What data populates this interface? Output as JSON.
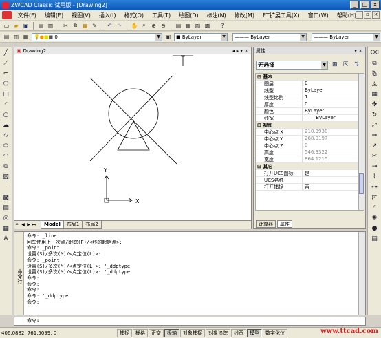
{
  "title": "ZWCAD Classic 试用版 - [Drawing2]",
  "menu": [
    "文件(F)",
    "编辑(E)",
    "视图(V)",
    "插入(I)",
    "格式(O)",
    "工具(T)",
    "绘图(D)",
    "标注(N)",
    "修改(M)",
    "ET扩展工具(X)",
    "窗口(W)",
    "帮助(H)"
  ],
  "toolbar": {
    "layer_value": "0",
    "color_value": "ByLayer",
    "linetype_value": "ByLayer",
    "lineweight_value": "ByLayer"
  },
  "drawing": {
    "tab_title": "Drawing2",
    "tabs": [
      "Model",
      "布局1",
      "布局2"
    ]
  },
  "ucs": {
    "x_label": "X",
    "y_label": "Y"
  },
  "properties": {
    "panel_title": "属性",
    "selection": "无选择",
    "rows": [
      {
        "cat": "基本"
      },
      {
        "k": "图层",
        "v": "0"
      },
      {
        "k": "线型",
        "v": "ByLayer"
      },
      {
        "k": "线型比例",
        "v": "1"
      },
      {
        "k": "厚度",
        "v": "0"
      },
      {
        "k": "颜色",
        "v": "ByLayer"
      },
      {
        "k": "线宽",
        "v": "—— ByLayer"
      },
      {
        "cat": "视图"
      },
      {
        "k": "中心点 X",
        "v": "210.3938",
        "gray": true
      },
      {
        "k": "中心点 Y",
        "v": "268.0197",
        "gray": true
      },
      {
        "k": "中心点 Z",
        "v": "0",
        "gray": true
      },
      {
        "k": "高度",
        "v": "546.3322",
        "gray": true
      },
      {
        "k": "宽度",
        "v": "864.1215",
        "gray": true
      },
      {
        "cat": "其它"
      },
      {
        "k": "打开UCS图标",
        "v": "是"
      },
      {
        "k": "UCS名称",
        "v": ""
      },
      {
        "k": "打开捕捉",
        "v": "否"
      }
    ],
    "tabs": [
      "计算器",
      "属性"
    ]
  },
  "command": {
    "label": "命令行",
    "lines": [
      "命令: _line",
      "回车使用上一次点/跟踪(F)/<线的起始点>:",
      "命令: _point",
      "设置(S)/多次(M)/<点定位(L)>:",
      "命令: _point",
      "设置(S)/多次(M)/<点定位(L)>: '_ddptype",
      "设置(S)/多次(M)/<点定位(L)>: '_ddptype",
      "命令:",
      "命令:",
      "命令:",
      "命令: '_ddptype",
      "命令:"
    ],
    "prompt": "命令:"
  },
  "status": {
    "coords": "406.0882, 761.5099, 0",
    "buttons": [
      "捕捉",
      "栅格",
      "正交",
      "极轴",
      "对象捕捉",
      "对象追踪",
      "线宽",
      "模型",
      "数字化仪"
    ]
  },
  "watermark": "www.ttcad.com"
}
